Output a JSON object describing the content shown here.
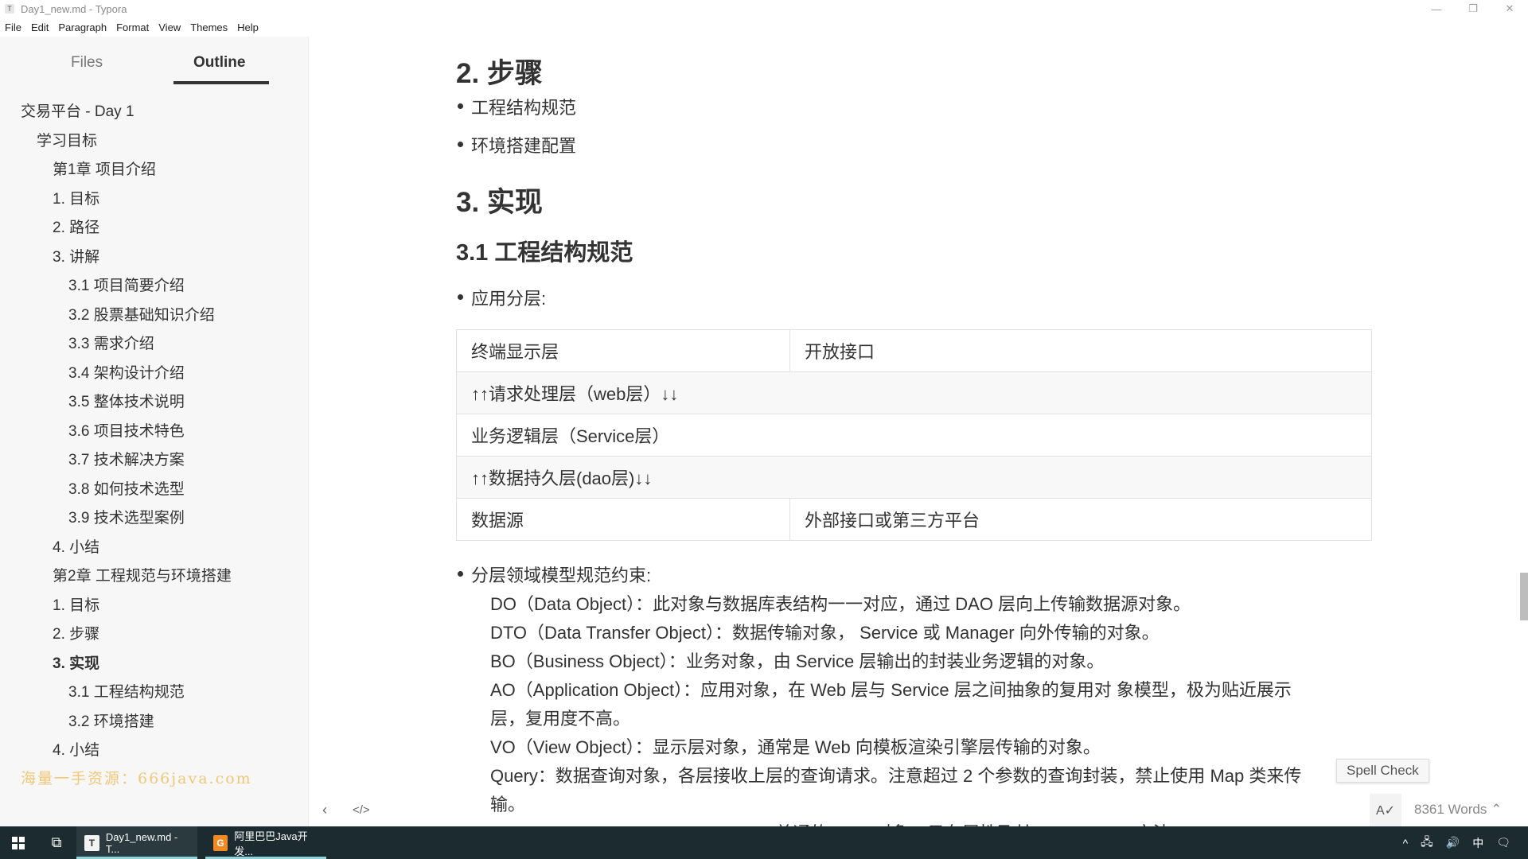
{
  "window": {
    "title": "Day1_new.md - Typora",
    "app_icon": "T",
    "controls": {
      "minimize": "—",
      "restore": "❐",
      "close": "✕"
    }
  },
  "menu": [
    "File",
    "Edit",
    "Paragraph",
    "Format",
    "View",
    "Themes",
    "Help"
  ],
  "sidebar": {
    "tabs": {
      "files": "Files",
      "outline": "Outline"
    },
    "active_tab": "Outline",
    "outline": [
      {
        "label": "交易平台 - Day 1",
        "level": 1
      },
      {
        "label": "学习目标",
        "level": 2
      },
      {
        "label": "第1章 项目介绍",
        "level": 3
      },
      {
        "label": "1. 目标",
        "level": 3
      },
      {
        "label": "2. 路径",
        "level": 3
      },
      {
        "label": "3. 讲解",
        "level": 3
      },
      {
        "label": "3.1 项目简要介绍",
        "level": 4
      },
      {
        "label": "3.2 股票基础知识介绍",
        "level": 4
      },
      {
        "label": "3.3 需求介绍",
        "level": 4
      },
      {
        "label": "3.4 架构设计介绍",
        "level": 4
      },
      {
        "label": "3.5 整体技术说明",
        "level": 4
      },
      {
        "label": "3.6 项目技术特色",
        "level": 4
      },
      {
        "label": "3.7 技术解决方案",
        "level": 4
      },
      {
        "label": "3.8 如何技术选型",
        "level": 4
      },
      {
        "label": "3.9 技术选型案例",
        "level": 4
      },
      {
        "label": "4. 小结",
        "level": 3
      },
      {
        "label": "第2章 工程规范与环境搭建",
        "level": 3
      },
      {
        "label": "1. 目标",
        "level": 3
      },
      {
        "label": "2. 步骤",
        "level": 3
      },
      {
        "label": "3. 实现",
        "level": 3,
        "active": true
      },
      {
        "label": "3.1 工程结构规范",
        "level": 4
      },
      {
        "label": "3.2 环境搭建",
        "level": 4
      },
      {
        "label": "4. 小结",
        "level": 3
      }
    ],
    "watermark": "海量一手资源：666java.com"
  },
  "document": {
    "h2_steps": "2. 步骤",
    "steps": [
      "工程结构规范",
      "环境搭建配置"
    ],
    "h2_impl": "3. 实现",
    "h3_struct": "3.1 工程结构规范",
    "bullet_layers": "应用分层:",
    "layers_table": [
      [
        "终端显示层",
        "开放接口"
      ],
      [
        "↑↑请求处理层（web层）↓↓",
        ""
      ],
      [
        "业务逻辑层（Service层）",
        ""
      ],
      [
        "↑↑数据持久层(dao层)↓↓",
        ""
      ],
      [
        "数据源",
        "外部接口或第三方平台"
      ]
    ],
    "bullet_models": "分层领域模型规范约束:",
    "model_lines": [
      "DO（Data Object）：此对象与数据库表结构一一对应，通过 DAO 层向上传输数据源对象。",
      "DTO（Data Transfer Object）：数据传输对象， Service 或 Manager 向外传输的对象。",
      "BO（Business Object）：业务对象，由 Service 层输出的封装业务逻辑的对象。",
      "AO（Application Object）：应用对象，在 Web 层与 Service 层之间抽象的复用对 象模型，极为贴近展示",
      "层，复用度不高。",
      "VO（View Object）：显示层对象，通常是 Web 向模板渲染引擎层传输的对象。",
      "Query：数据查询对象，各层接收上层的查询请求。注意超过 2 个参数的查询封装，禁止使用 Map 类来传",
      "输。",
      "POJO(Plain Ordinary Java Object)：普通的 Java 对象，只有属性及其 getter/setter 方法。"
    ]
  },
  "tooltip": "Spell Check",
  "statusbar": {
    "back_icon": "‹",
    "source_icon": "</>",
    "spell_icon": "A✓",
    "word_count": "8361 Words ⌃"
  },
  "taskbar": {
    "apps": [
      {
        "label": "Day1_new.md - T...",
        "icon": "T"
      },
      {
        "label": "阿里巴巴Java开发...",
        "icon": "G"
      }
    ],
    "tray": [
      "^",
      "🖧",
      "🔊",
      "中",
      "🗨"
    ]
  }
}
